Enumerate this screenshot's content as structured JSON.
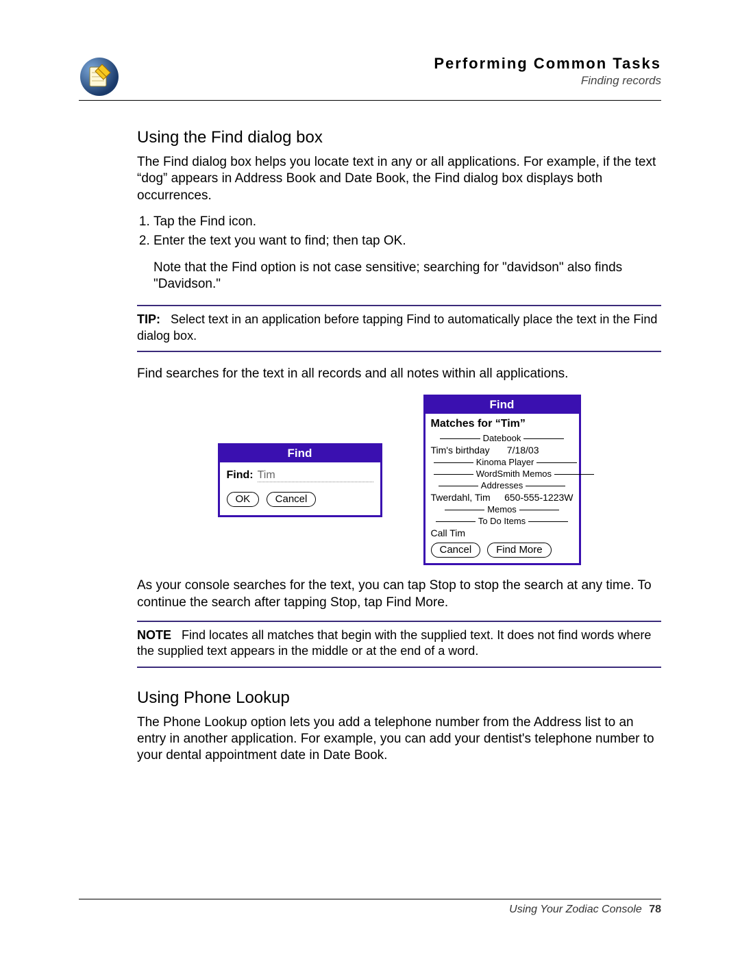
{
  "header": {
    "chapter": "Performing Common Tasks",
    "subsection": "Finding records"
  },
  "section1": {
    "title": "Using the Find dialog box",
    "intro": "The Find dialog box helps you locate text in any or all applications. For example, if the text “dog” appears in Address Book and Date Book, the Find dialog box displays both occurrences.",
    "step1": "Tap the Find icon.",
    "step2": "Enter the text you want to find; then tap OK.",
    "note_indent": "Note that the Find option is not case sensitive; searching for \"davidson\" also finds \"Davidson.\"",
    "tip_label": "TIP:",
    "tip_body": "Select text in an application before tapping Find to automatically place the text in the Find dialog box.",
    "after_tip": "Find searches for the text in all records and all notes within all applications.",
    "after_dialogs": "As your console searches for the text, you can tap Stop to stop the search at any time. To continue the search after tapping Stop, tap Find More.",
    "note_label": "NOTE",
    "note_body": "Find locates all matches that begin with the supplied text. It does not find words where the supplied text appears in the middle or at the end of a word."
  },
  "find_dialog": {
    "title": "Find",
    "label": "Find:",
    "value": "Tim",
    "ok": "OK",
    "cancel": "Cancel"
  },
  "results_dialog": {
    "title": "Find",
    "header": "Matches for “Tim”",
    "cats": {
      "datebook": "Datebook",
      "kinoma": "Kinoma Player",
      "wordsmith": "WordSmith Memos",
      "addresses": "Addresses",
      "memos": "Memos",
      "todo": "To Do Items"
    },
    "rows": {
      "bday_l": "Tim's birthday",
      "bday_r": "7/18/03",
      "addr_l": "Twerdahl, Tim",
      "addr_r": "650-555-1223W",
      "todo": "Call Tim"
    },
    "cancel": "Cancel",
    "findmore": "Find More"
  },
  "section2": {
    "title": "Using Phone Lookup",
    "body": "The Phone Lookup option lets you add a telephone number from the Address list to an entry in another application. For example, you can add your dentist's telephone number to your dental appointment date in Date Book."
  },
  "footer": {
    "text": "Using Your Zodiac Console",
    "page": "78"
  }
}
